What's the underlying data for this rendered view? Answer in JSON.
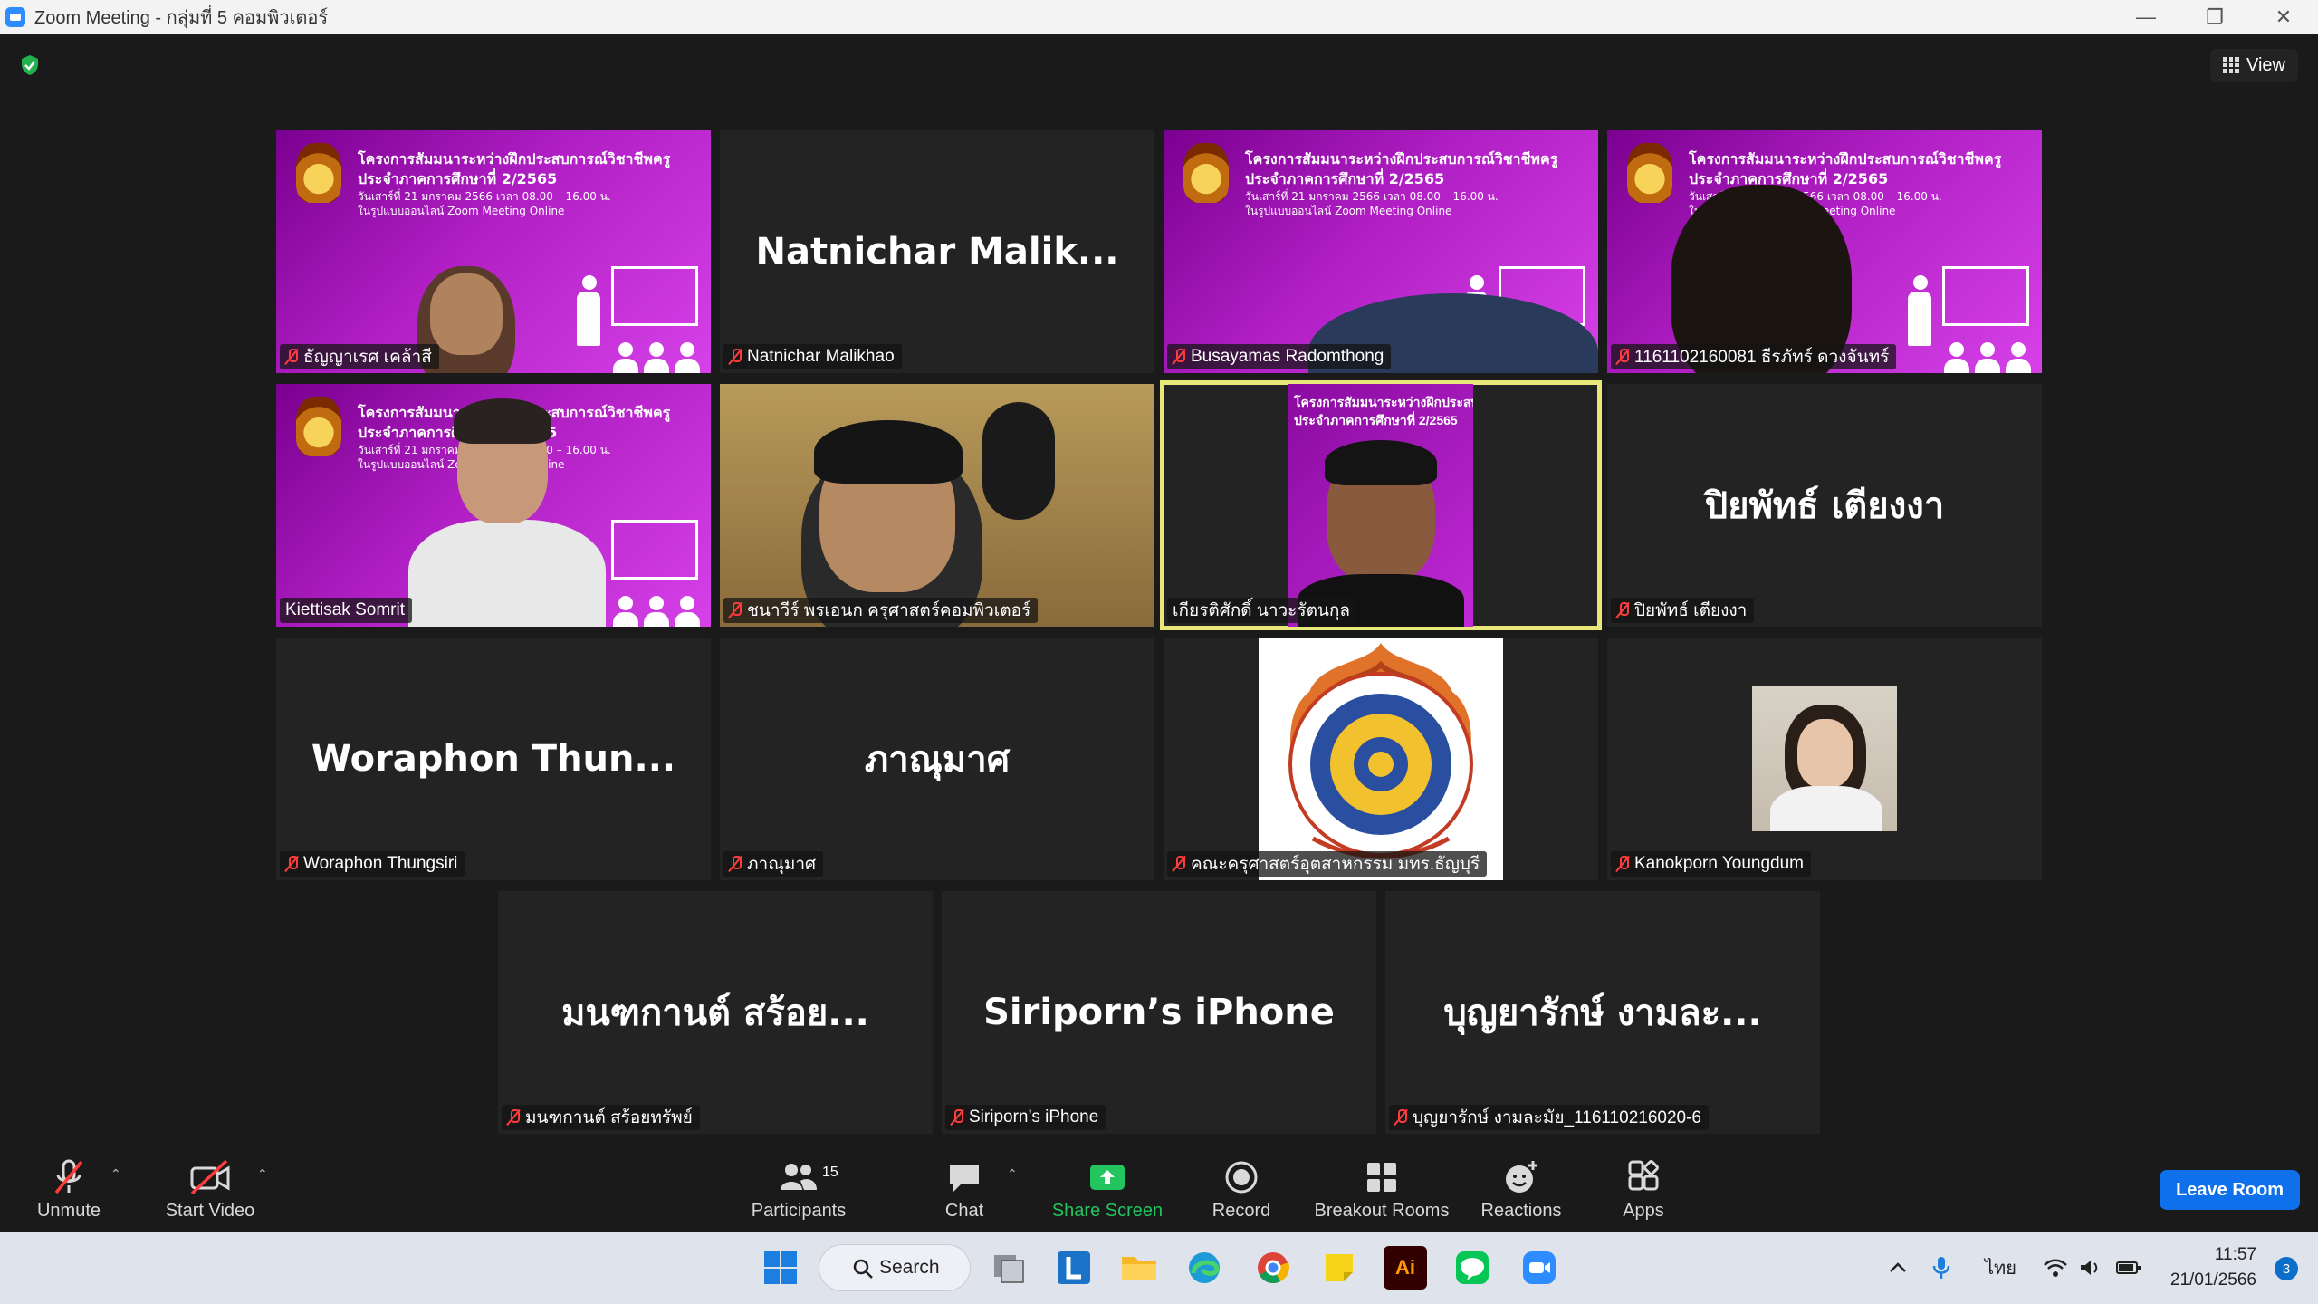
{
  "window": {
    "title": "Zoom Meeting - กลุ่มที่ 5 คอมพิวเตอร์",
    "controls": {
      "minimize": "—",
      "restore": "❐",
      "close": "✕"
    }
  },
  "meeting": {
    "view_label": "View",
    "slide": {
      "line1": "โครงการสัมมนาระหว่างฝึกประสบการณ์วิชาชีพครู",
      "line2": "ประจำภาคการศึกษาที่ 2/2565",
      "line3": "วันเสาร์ที่ 21 มกราคม 2566 เวลา 08.00 – 16.00 น.",
      "line4": "ในรูปแบบออนไลน์ Zoom Meeting Online"
    },
    "tiles": [
      {
        "name": "ธัญญาเรศ เคล้าสี",
        "muted": true,
        "kind": "slide-person"
      },
      {
        "name": "Natnichar Malikhao",
        "display": "Natnichar  Malik...",
        "muted": true,
        "kind": "name"
      },
      {
        "name": "Busayamas Radomthong",
        "muted": true,
        "kind": "slide-person"
      },
      {
        "name": "1161102160081 ธีรภัทร์ ดวงจันทร์",
        "muted": true,
        "kind": "slide-person"
      },
      {
        "name": "Kiettisak Somrit",
        "muted": false,
        "kind": "slide-person"
      },
      {
        "name": "ชนาวีร์ พรเอนก ครุศาสตร์คอมพิวเตอร์",
        "muted": true,
        "kind": "camera"
      },
      {
        "name": "เกียรติศักดิ์ นาวะรัตนกุล",
        "muted": false,
        "kind": "camera-active"
      },
      {
        "name": "ปิยพัทธ์ เตียงงา",
        "display": "ปิยพัทธ์ เตียงงา",
        "muted": true,
        "kind": "name"
      },
      {
        "name": "Woraphon Thungsiri",
        "display": "Woraphon  Thun...",
        "muted": true,
        "kind": "name"
      },
      {
        "name": "ภาณุมาศ",
        "display": "ภาณุมาศ",
        "muted": true,
        "kind": "name"
      },
      {
        "name": "คณะครุศาสตร์อุตสาหกรรม มทร.ธัญบุรี",
        "muted": true,
        "kind": "logo"
      },
      {
        "name": "Kanokporn Youngdum",
        "muted": true,
        "kind": "photo"
      },
      {
        "name": "มนฑกานต์ สร้อยทรัพย์",
        "display": "มนฑกานต์ สร้อย...",
        "muted": true,
        "kind": "name"
      },
      {
        "name": "Siriporn’s iPhone",
        "display": "Siriporn’s iPhone",
        "muted": true,
        "kind": "name"
      },
      {
        "name": "บุญยารักษ์ งามละมัย_116110216020-6",
        "display": "บุญยารักษ์ งามละ...",
        "muted": true,
        "kind": "name"
      }
    ]
  },
  "toolbar": {
    "unmute": "Unmute",
    "start_video": "Start Video",
    "participants": "Participants",
    "participants_count": "15",
    "chat": "Chat",
    "share_screen": "Share Screen",
    "record": "Record",
    "breakout_rooms": "Breakout Rooms",
    "reactions": "Reactions",
    "apps": "Apps",
    "leave": "Leave Room"
  },
  "taskbar": {
    "search": "Search",
    "lang": "ไทย",
    "time": "11:57",
    "date": "21/01/2566",
    "notifications": "3",
    "ai_label": "Ai"
  },
  "colors": {
    "share_green": "#22c55e",
    "accent_blue": "#0e71eb",
    "active_border": "#e8e87a",
    "muted_red": "#ff3b3b"
  }
}
